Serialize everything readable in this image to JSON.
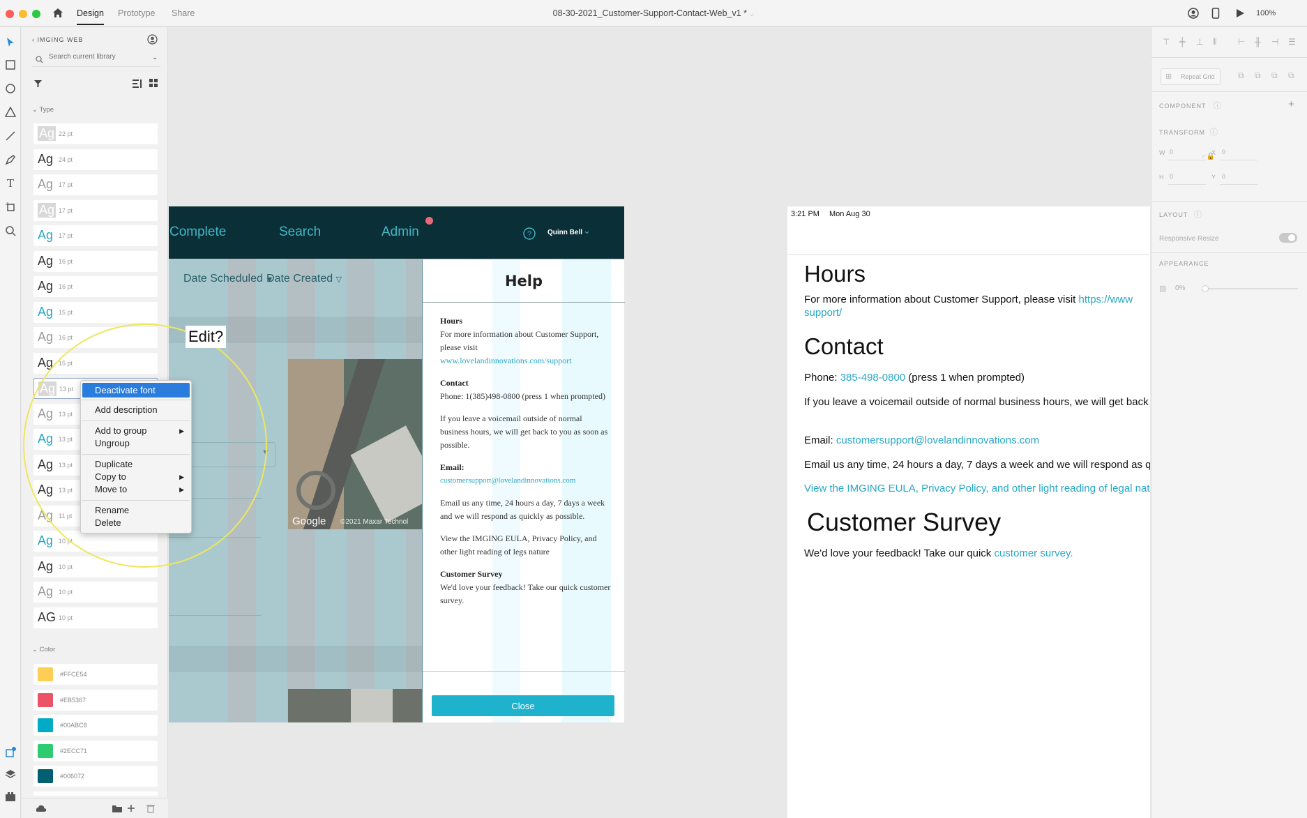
{
  "titlebar": {
    "tabs": [
      "Design",
      "Prototype",
      "Share"
    ],
    "doc_title": "08-30-2021_Customer-Support-Contact-Web_v1 *",
    "zoom": "100%"
  },
  "library": {
    "name": "IMGING WEB",
    "search_placeholder": "Search current library",
    "type_section": "Type",
    "color_section": "Color",
    "type_styles": [
      {
        "glyph": "Ag",
        "size": "22 pt",
        "color": "#d8d8d8",
        "selected": true
      },
      {
        "glyph": "Ag",
        "size": "24 pt",
        "color": "#333333"
      },
      {
        "glyph": "Ag",
        "size": "17 pt",
        "color": "#999999"
      },
      {
        "glyph": "Ag",
        "size": "17 pt",
        "color": "#d8d8d8",
        "selected": true
      },
      {
        "glyph": "Ag",
        "size": "17 pt",
        "color": "#29a7c4"
      },
      {
        "glyph": "Ag",
        "size": "16 pt",
        "color": "#333333"
      },
      {
        "glyph": "Ag",
        "size": "16 pt",
        "color": "#333333"
      },
      {
        "glyph": "Ag",
        "size": "15 pt",
        "color": "#29a7c4"
      },
      {
        "glyph": "Ag",
        "size": "16 pt",
        "color": "#999999"
      },
      {
        "glyph": "Ag",
        "size": "15 pt",
        "color": "#333333"
      },
      {
        "glyph": "Ag",
        "size": "13 pt",
        "color": "#d8d8d8",
        "selected": true
      },
      {
        "glyph": "Ag",
        "size": "13 pt",
        "color": "#999999"
      },
      {
        "glyph": "Ag",
        "size": "13 pt",
        "color": "#29a7c4"
      },
      {
        "glyph": "Ag",
        "size": "13 pt",
        "color": "#333333"
      },
      {
        "glyph": "Ag",
        "size": "13 pt",
        "color": "#333333"
      },
      {
        "glyph": "Ag",
        "size": "11 pt",
        "color": "#999999"
      },
      {
        "glyph": "Ag",
        "size": "10 pt",
        "color": "#29a7c4"
      },
      {
        "glyph": "Ag",
        "size": "10 pt",
        "color": "#333333"
      },
      {
        "glyph": "Ag",
        "size": "10 pt",
        "color": "#999999"
      },
      {
        "glyph": "AG",
        "size": "10 pt",
        "color": "#333333"
      }
    ],
    "colors": [
      "#FFCE54",
      "#EB5367",
      "#00ABC8",
      "#2ECC71",
      "#006072"
    ]
  },
  "context_menu": {
    "items": [
      "Deactivate font",
      "Add description",
      "Add to group",
      "Ungroup",
      "Duplicate",
      "Copy to",
      "Move to",
      "Rename",
      "Delete"
    ]
  },
  "edit_tag": "Edit?",
  "artboard_web": {
    "nav": [
      "Complete",
      "Search",
      "Admin"
    ],
    "user": "Quinn Bell",
    "filters": [
      "Date Scheduled",
      "Date Created"
    ],
    "map_credit": "Google",
    "map_copyright": "©2021 Maxar Technol",
    "help": {
      "title": "Help",
      "hours_h": "Hours",
      "hours_t": "For more information about Customer Support, please visit",
      "hours_link": "www.lovelandinnovations.com/support",
      "contact_h": "Contact",
      "contact_t": "Phone: 1(385)498-0800  (press 1 when prompted)",
      "voicemail_t": "If you leave a voicemail outside of normal business hours, we will get back to you as soon as possible.",
      "email_h": "Email:",
      "email_link": "customersupport@lovelandinnovations.com",
      "email_t": "Email us any time, 24 hours a day, 7 days a week and we will respond as quickly as possible.",
      "eula_t": "View the IMGING EULA, Privacy Policy, and other light reading of legs nature",
      "survey_h": "Customer Survey",
      "survey_t": "We'd love your feedback! Take our quick customer survey.",
      "close": "Close"
    }
  },
  "artboard_ipad": {
    "status_time": "3:21 PM",
    "status_date": "Mon Aug 30",
    "hours_h": "Hours",
    "hours_t": "For more information about Customer Support, please visit",
    "hours_link": "https://www",
    "hours_link2": "support/",
    "contact_h": "Contact",
    "phone_label": "Phone:",
    "phone_link": "385-498-0800",
    "phone_note": "(press 1 when prompted)",
    "voicemail_t": "If you leave a voicemail outside of normal business hours, we will get back t",
    "email_label": "Email:",
    "email_link": "customersupport@lovelandinnovations.com",
    "email_t": "Email us any time, 24 hours a day, 7 days a week and we will respond as qui",
    "eula_link": "View the IMGING EULA, Privacy Policy, and other light reading of legal natu",
    "survey_h": "Customer Survey",
    "survey_t": "We'd love your feedback! Take our quick",
    "survey_link": "customer survey."
  },
  "inspector": {
    "repeat_grid": "Repeat Grid",
    "component": "COMPONENT",
    "transform": "TRANSFORM",
    "w_label": "W",
    "w_val": "0",
    "x_label": "X",
    "x_val": "0",
    "h_label": "H",
    "h_val": "0",
    "y_label": "Y",
    "y_val": "0",
    "layout": "LAYOUT",
    "responsive_resize": "Responsive Resize",
    "appearance": "APPEARANCE",
    "opacity": "0%"
  }
}
